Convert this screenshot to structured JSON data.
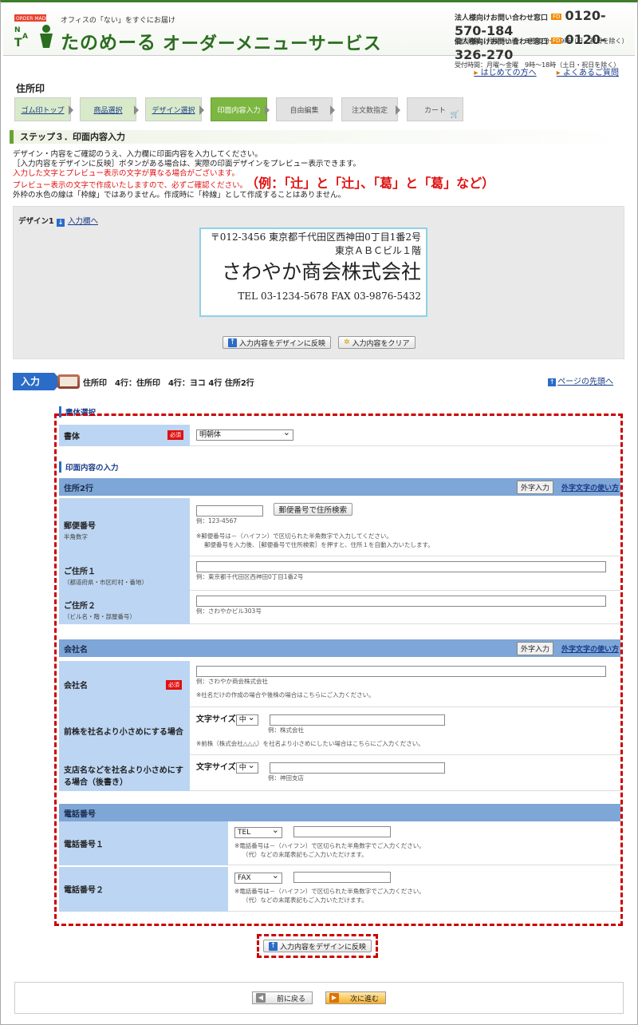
{
  "header": {
    "logo_badge": "オーダーメイド",
    "logo_letters": "TANO",
    "tagline": "オフィスの「ない」をすぐにお届け",
    "brand": "たのめーる",
    "service": "オーダーメニューサービス",
    "corp_label": "法人様向けお問い合わせ窓口",
    "corp_phone": "0120-570-184",
    "corp_hours": "受付時間：月曜～土曜　8時30分～19時（日・祝日を除く）",
    "personal_label": "個人様向けお問い合わせ窓口",
    "personal_phone": "0120-326-270",
    "personal_hours": "受付時間：月曜～金曜　9時～18時（土日・祝日を除く）",
    "free_dial": "FD"
  },
  "toplinks": {
    "first": "はじめての方へ",
    "faq": "よくあるご質問"
  },
  "page_title": "住所印",
  "steps": [
    {
      "label": "ゴム印トップ"
    },
    {
      "label": "商品選択"
    },
    {
      "label": "デザイン選択"
    },
    {
      "label": "印面内容入力"
    },
    {
      "label": "自由編集"
    },
    {
      "label": "注文数指定"
    },
    {
      "label": "カート"
    }
  ],
  "step_title": "ステップ３．印面内容入力",
  "intro": {
    "line1": "デザイン・内容をご確認のうえ、入力欄に印面内容を入力してください。",
    "line2": "［入力内容をデザインに反映］ボタンがある場合は、実際の印面デザインをプレビュー表示できます。",
    "line3": "入力した文字とプレビュー表示の文字が異なる場合がございます。",
    "line4": "プレビュー表示の文字で作成いたしますので、必ずご確認ください。",
    "example": "（例：「辻」と「辻」、「葛」と「葛」など）",
    "line5": "外枠の水色の線は「枠線」ではありません。作成時に「枠線」として作成することはありません。"
  },
  "preview": {
    "design_label": "デザイン1",
    "to_input": "入力欄へ",
    "stamp": {
      "line1": "〒012-3456 東京都千代田区西神田0丁目1番2号",
      "line2": "東京ＡＢＣビル１階",
      "line3": "さわやか商会株式会社",
      "line4": "TEL 03-1234-5678 FAX 03-9876-5432"
    },
    "reflect_btn": "入力内容をデザインに反映",
    "clear_btn": "入力内容をクリア"
  },
  "input_header": {
    "badge": "入力",
    "text": "住所印　4行：住所印　4行：ヨコ 4行 住所2行",
    "page_top": "ページの先頭へ"
  },
  "font_section": {
    "title": "書体選択",
    "label": "書体",
    "required": "必須",
    "value": "明朝体"
  },
  "content_section": {
    "title": "印面内容の入力"
  },
  "gaiji_btn": "外字入力",
  "gaiji_link": "外字文字の使い方",
  "address": {
    "bar": "住所2行",
    "postal": {
      "label": "郵便番号",
      "sub": "半角数字",
      "search_btn": "郵便番号で住所検索",
      "example": "例：123-4567",
      "note1": "※郵便番号は－（ハイフン）で区切られた半角数字で入力してください。",
      "note2": "郵便番号を入力後、［郵便番号で住所検索］を押すと、住所１を自動入力いたします。"
    },
    "addr1": {
      "label": "ご住所１",
      "sub": "（都道府県・市区町村・番地）",
      "example": "例：東京都千代田区西神田0丁目1番2号"
    },
    "addr2": {
      "label": "ご住所２",
      "sub": "（ビル名・階・部屋番号）",
      "example": "例：さわやかビル303号"
    }
  },
  "company": {
    "bar": "会社名",
    "name": {
      "label": "会社名",
      "required": "必須",
      "example": "例：さわやか商会株式会社",
      "note": "※社名だけの作成の場合や後株の場合はこちらにご入力ください。"
    },
    "prefix": {
      "label": "前株を社名より小さめにする場合",
      "size_label": "文字サイズ",
      "size": "中",
      "example": "例：株式会社",
      "note": "※前株（株式会社△△△）を社名より小さめにしたい場合はこちらにご入力ください。"
    },
    "suffix": {
      "label": "支店名などを社名より小さめにする場合（後書き）",
      "size_label": "文字サイズ",
      "size": "中",
      "example": "例：神田支店"
    }
  },
  "phone": {
    "bar": "電話番号",
    "tel1": {
      "label": "電話番号１",
      "type": "TEL",
      "note1": "※電話番号は－（ハイフン）で区切られた半角数字でご入力ください。",
      "note2": "（代）などの末尾表記もご入力いただけます。"
    },
    "tel2": {
      "label": "電話番号２",
      "type": "FAX",
      "note1": "※電話番号は－（ハイフン）で区切られた半角数字でご入力ください。",
      "note2": "（代）などの末尾表記もご入力いただけます。"
    }
  },
  "bottom_reflect": "入力内容をデザインに反映",
  "nav": {
    "back": "前に戻る",
    "next": "次に進む"
  },
  "colors": {
    "brand_green": "#2a6e1f",
    "step_current": "#7cb742",
    "label_bg": "#bcd5f2",
    "bar_bg": "#7ea6d6",
    "highlight_red": "#cc0000"
  }
}
